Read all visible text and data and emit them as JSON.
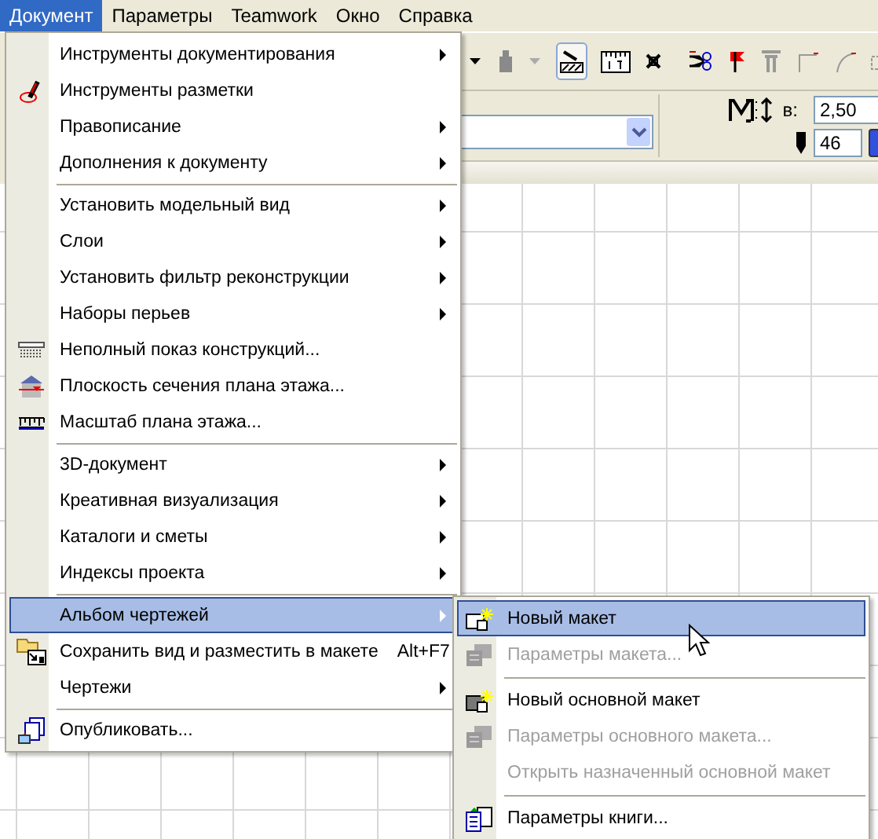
{
  "menubar": [
    {
      "label": "Документ",
      "selected": true
    },
    {
      "label": "Параметры",
      "selected": false
    },
    {
      "label": "Teamwork",
      "selected": false
    },
    {
      "label": "Окно",
      "selected": false
    },
    {
      "label": "Справка",
      "selected": false
    }
  ],
  "toolbar": {
    "height_label": "в:",
    "height_value": "2,50",
    "pen_value": "46"
  },
  "menu": {
    "items": [
      {
        "kind": "item",
        "label": "Инструменты документирования",
        "submenu": true,
        "selected": false
      },
      {
        "kind": "item",
        "label": "Инструменты разметки",
        "submenu": false,
        "selected": false
      },
      {
        "kind": "item",
        "label": "Правописание",
        "submenu": true,
        "selected": false
      },
      {
        "kind": "item",
        "label": "Дополнения к документу",
        "submenu": true,
        "selected": false
      },
      {
        "kind": "separator"
      },
      {
        "kind": "item",
        "label": "Установить модельный вид",
        "submenu": true,
        "selected": false
      },
      {
        "kind": "item",
        "label": "Слои",
        "submenu": true,
        "selected": false
      },
      {
        "kind": "item",
        "label": "Установить фильтр реконструкции",
        "submenu": true,
        "selected": false
      },
      {
        "kind": "item",
        "label": "Наборы перьев",
        "submenu": true,
        "selected": false
      },
      {
        "kind": "item",
        "label": "Неполный показ конструкций...",
        "submenu": false,
        "selected": false
      },
      {
        "kind": "item",
        "label": "Плоскость сечения плана этажа...",
        "submenu": false,
        "selected": false
      },
      {
        "kind": "item",
        "label": "Масштаб плана этажа...",
        "submenu": false,
        "selected": false
      },
      {
        "kind": "separator"
      },
      {
        "kind": "item",
        "label": "3D-документ",
        "submenu": true,
        "selected": false
      },
      {
        "kind": "item",
        "label": "Креативная визуализация",
        "submenu": true,
        "selected": false
      },
      {
        "kind": "item",
        "label": "Каталоги и сметы",
        "submenu": true,
        "selected": false
      },
      {
        "kind": "item",
        "label": "Индексы проекта",
        "submenu": true,
        "selected": false
      },
      {
        "kind": "separator"
      },
      {
        "kind": "item",
        "label": "Альбом чертежей",
        "submenu": true,
        "selected": true
      },
      {
        "kind": "item",
        "label": "Сохранить вид и разместить в макете",
        "shortcut": "Alt+F7",
        "submenu": false,
        "selected": false
      },
      {
        "kind": "item",
        "label": "Чертежи",
        "submenu": true,
        "selected": false
      },
      {
        "kind": "separator"
      },
      {
        "kind": "item",
        "label": "Опубликовать...",
        "submenu": false,
        "selected": false
      }
    ]
  },
  "submenu": {
    "items": [
      {
        "kind": "item",
        "label": "Новый макет",
        "selected": true,
        "disabled": false
      },
      {
        "kind": "item",
        "label": "Параметры макета...",
        "selected": false,
        "disabled": true
      },
      {
        "kind": "separator"
      },
      {
        "kind": "item",
        "label": "Новый основной макет",
        "selected": false,
        "disabled": false
      },
      {
        "kind": "item",
        "label": "Параметры основного макета...",
        "selected": false,
        "disabled": true
      },
      {
        "kind": "item",
        "label": "Открыть назначенный основной макет",
        "selected": false,
        "disabled": true
      },
      {
        "kind": "separator"
      },
      {
        "kind": "item",
        "label": "Параметры книги...",
        "selected": false,
        "disabled": false
      }
    ]
  }
}
